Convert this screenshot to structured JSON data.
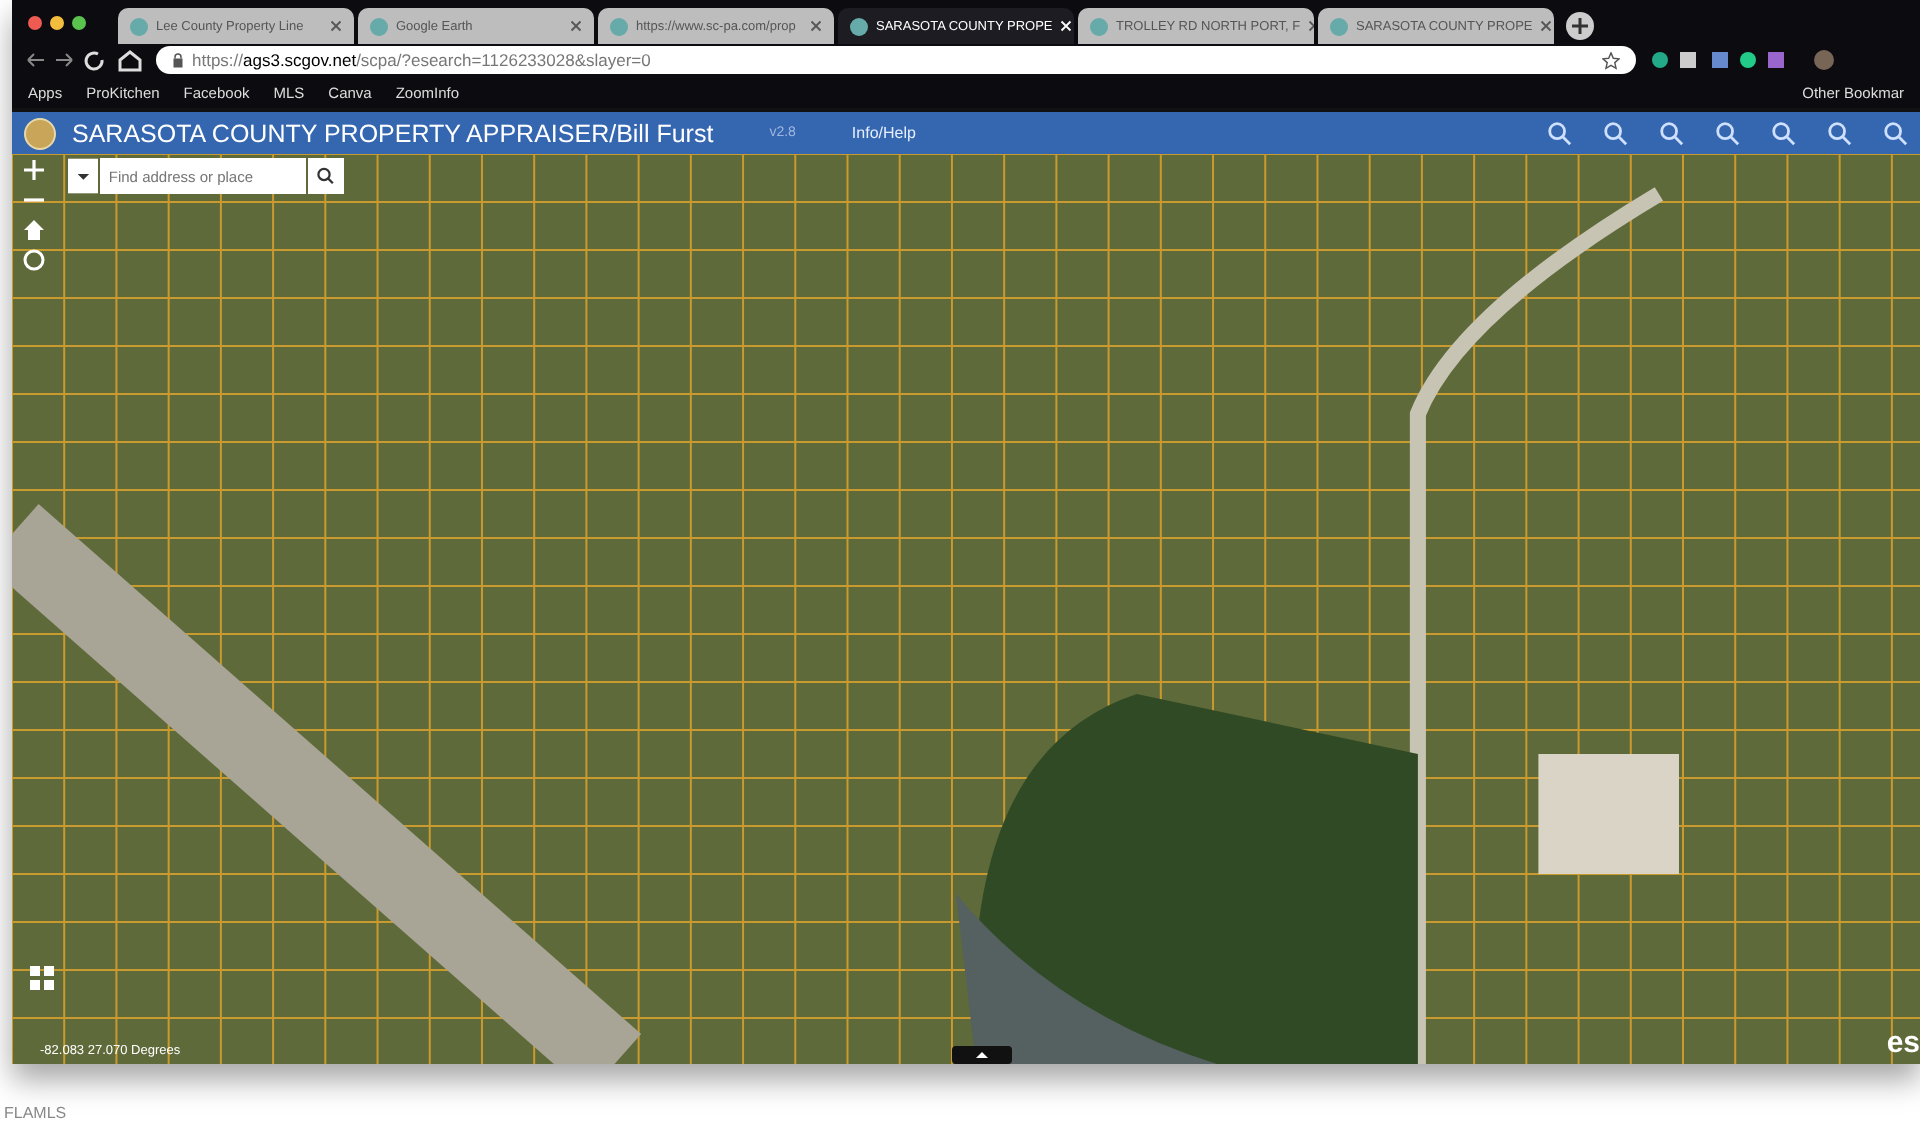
{
  "browser": {
    "tabs": [
      {
        "label": "Lee County Property Line",
        "selected": false
      },
      {
        "label": "Google Earth",
        "selected": false
      },
      {
        "label": "https://www.sc-pa.com/prop",
        "selected": false
      },
      {
        "label": "SARASOTA COUNTY PROPE",
        "selected": true
      },
      {
        "label": "TROLLEY RD NORTH PORT, F",
        "selected": false
      },
      {
        "label": "SARASOTA COUNTY PROPE",
        "selected": false
      }
    ],
    "url": {
      "host": "ags3.scgov.net",
      "prefix": "https://",
      "path": "/scpa/?esearch=1126233028&slayer=0"
    },
    "bookmarks": [
      "Apps",
      "ProKitchen",
      "Facebook",
      "MLS",
      "Canva",
      "ZoomInfo"
    ],
    "other_bookmarks": "Other Bookmar"
  },
  "app": {
    "title": "SARASOTA COUNTY PROPERTY APPRAISER/Bill Furst",
    "version": "v2.8",
    "menu": "Info/Help"
  },
  "map": {
    "search": {
      "placeholder": "Find address or place"
    },
    "coordinates": "-82.083 27.070 Degrees",
    "logo": "es"
  },
  "caption": "FLAMLS"
}
